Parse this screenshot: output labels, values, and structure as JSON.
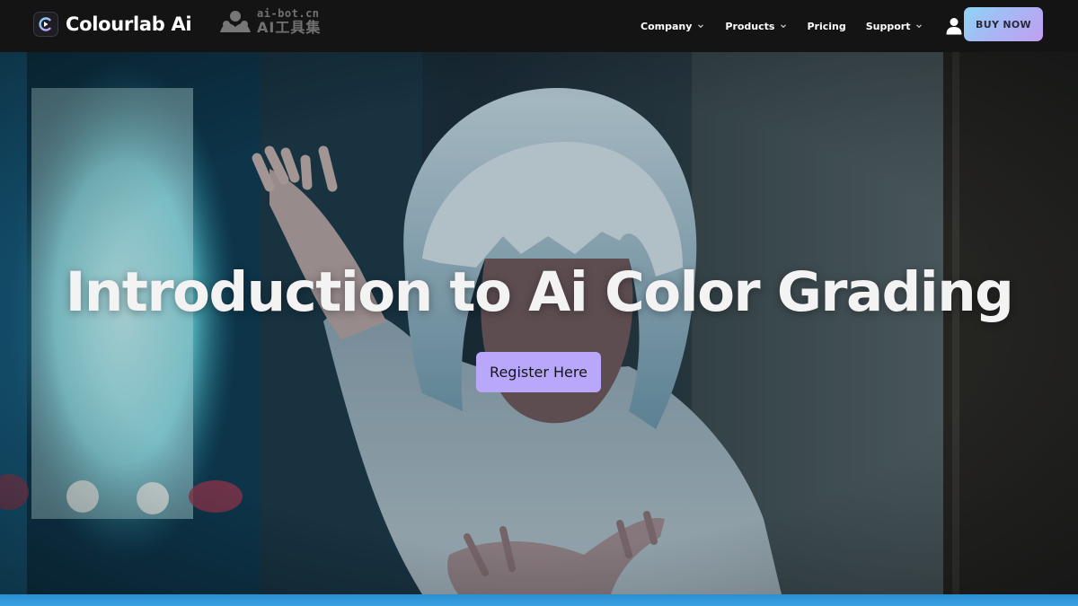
{
  "header": {
    "brand_name": "Colourlab Ai",
    "watermark": {
      "top": "ai-bot.cn",
      "bottom": "AI工具集"
    },
    "nav": [
      {
        "label": "Company",
        "has_dropdown": true
      },
      {
        "label": "Products",
        "has_dropdown": true
      },
      {
        "label": "Pricing",
        "has_dropdown": false
      },
      {
        "label": "Support",
        "has_dropdown": true
      }
    ],
    "user_icon": "user-icon",
    "buy_label": "BUY NOW"
  },
  "hero": {
    "title": "Introduction to Ai Color Grading",
    "cta_label": "Register Here"
  },
  "colors": {
    "nav_bg": "#141414",
    "cta_bg": "#b9a7fb",
    "buy_gradient": [
      "#8fd4f5",
      "#c29ef2"
    ],
    "bottom_strip": "#3aa2e0"
  }
}
